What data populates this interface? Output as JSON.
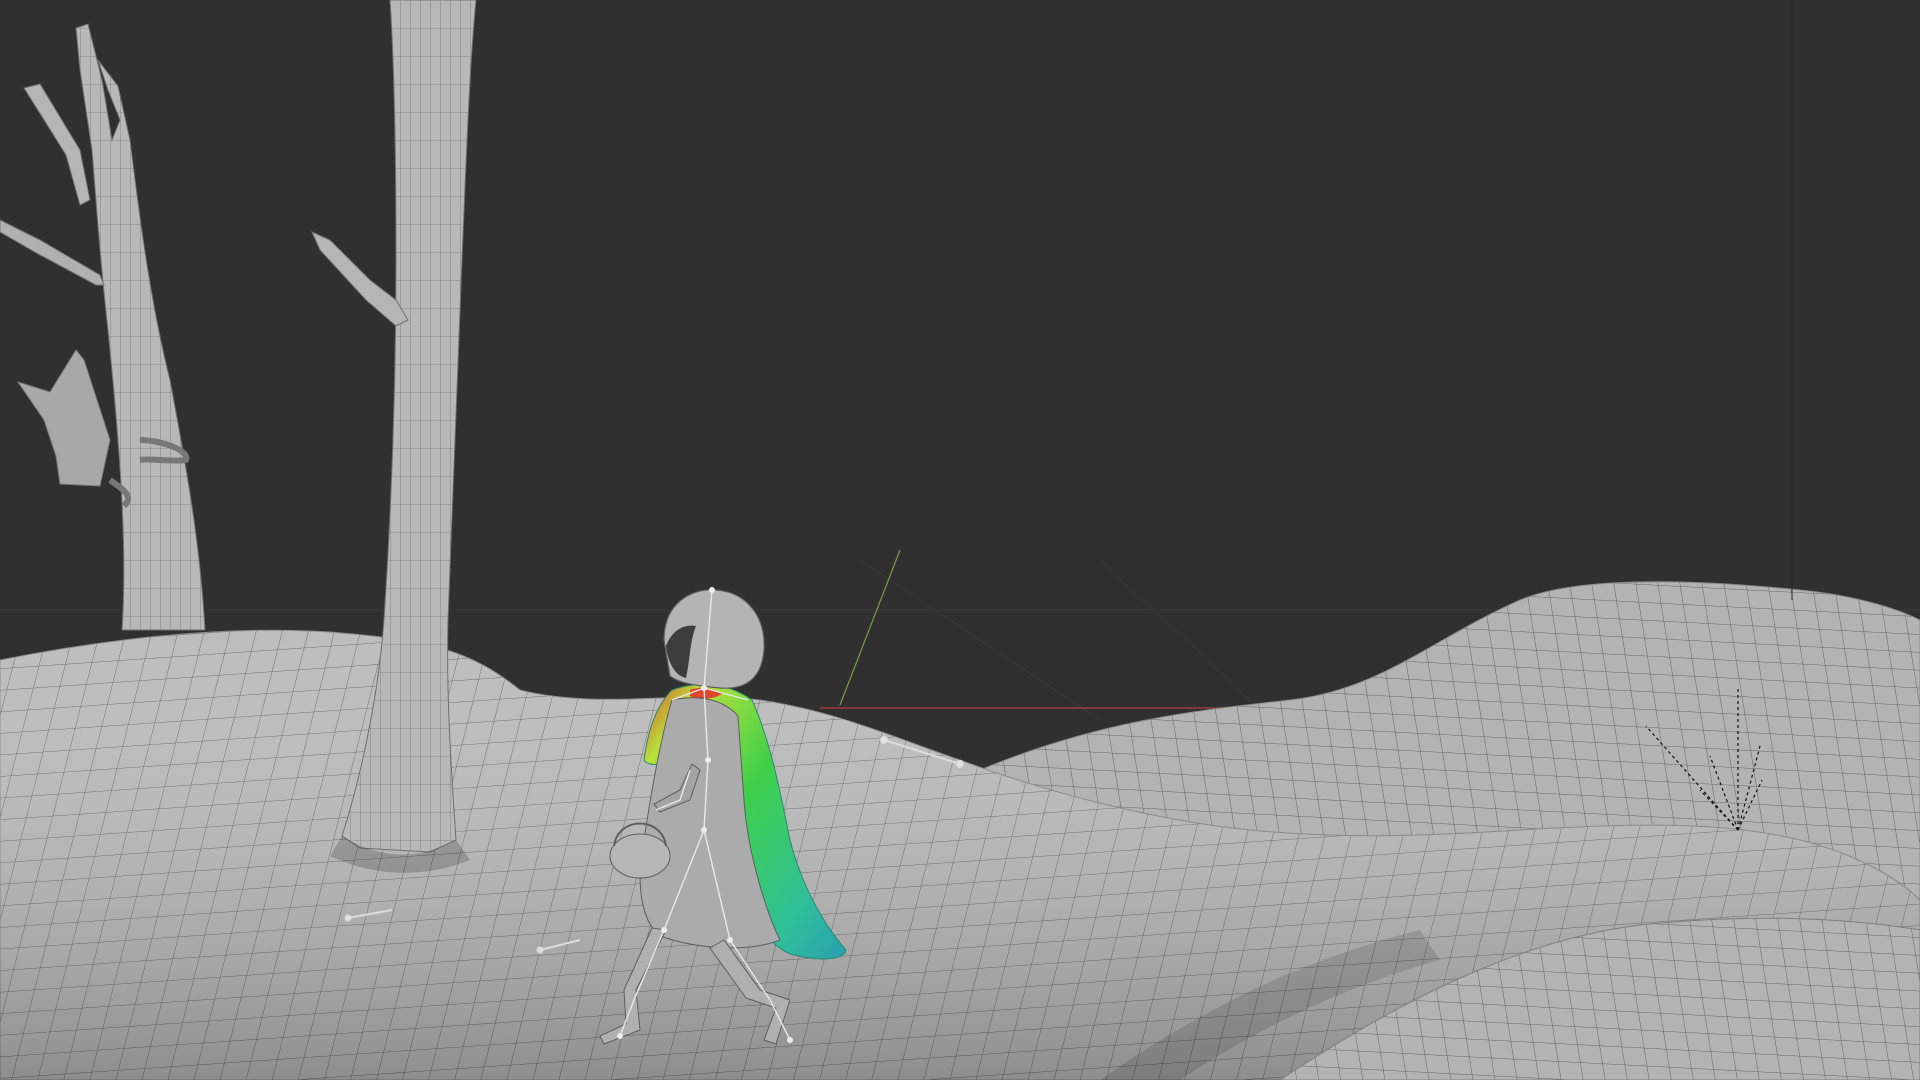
{
  "viewport": {
    "background_color": "#303030",
    "mesh_color": "#b9b9b9",
    "mesh_shadow_color": "#8a8a8a",
    "wire_color": "#5a5a5a",
    "cape_colors": [
      "#2fbf9a",
      "#3fd04a",
      "#b7e23a",
      "#e0462e"
    ],
    "axis_x_color": "#b54040",
    "axis_y_color": "#8fb54a"
  },
  "scene": {
    "objects": [
      {
        "name": "terrain",
        "icon": "terrain-mesh"
      },
      {
        "name": "tree-left",
        "icon": "tree-mesh"
      },
      {
        "name": "tree-center",
        "icon": "tree-mesh"
      },
      {
        "name": "character",
        "icon": "armature"
      },
      {
        "name": "cape",
        "icon": "cloth-weight-paint"
      },
      {
        "name": "light-gizmo",
        "icon": "spot-light"
      }
    ]
  }
}
